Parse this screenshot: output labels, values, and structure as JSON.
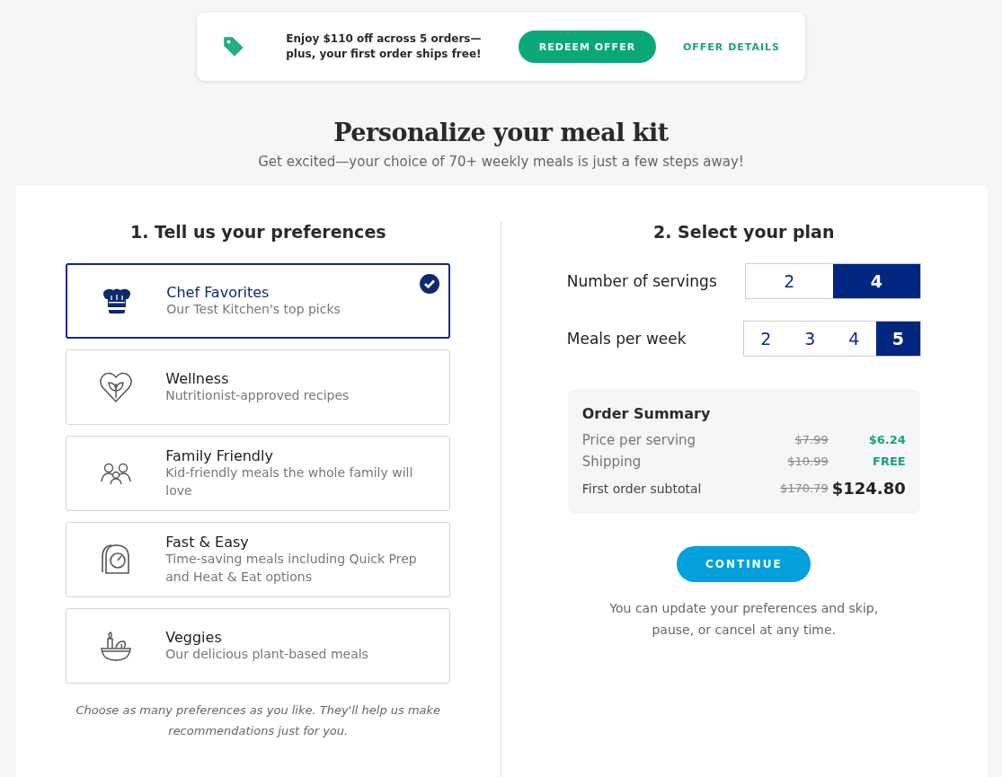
{
  "promo": {
    "message": "Enjoy $110 off across 5 orders—plus, your first order ships free!",
    "redeem": "REDEEM OFFER",
    "details": "OFFER DETAILS"
  },
  "heading": {
    "title": "Personalize your meal kit",
    "subtitle": "Get excited—your choice of 70+ weekly meals is just a few steps away!"
  },
  "preferences": {
    "title": "1. Tell us your preferences",
    "items": [
      {
        "kind": "chef",
        "name": "Chef Favorites",
        "description": "Our Test Kitchen's top picks",
        "selected": true
      },
      {
        "kind": "wellness",
        "name": "Wellness",
        "description": "Nutritionist-approved recipes",
        "selected": false
      },
      {
        "kind": "family",
        "name": "Family Friendly",
        "description": "Kid-friendly meals the whole family will love",
        "selected": false
      },
      {
        "kind": "fast",
        "name": "Fast & Easy",
        "description": "Time-saving meals including Quick Prep and Heat & Eat options",
        "selected": false
      },
      {
        "kind": "veggies",
        "name": "Veggies",
        "description": "Our delicious plant-based meals",
        "selected": false
      }
    ],
    "note": "Choose as many preferences as you like. They'll help us make recommendations just for you."
  },
  "plan": {
    "title": "2. Select your plan",
    "options": [
      {
        "label": "Number of servings",
        "choices": [
          {
            "label": "2",
            "selected": false
          },
          {
            "label": "4",
            "selected": true
          }
        ]
      },
      {
        "label": "Meals per week",
        "choices": [
          {
            "label": "2",
            "selected": false
          },
          {
            "label": "3",
            "selected": false
          },
          {
            "label": "4",
            "selected": false
          },
          {
            "label": "5",
            "selected": true
          }
        ]
      }
    ],
    "summary": {
      "title": "Order Summary",
      "rows": [
        {
          "kind": "line",
          "label": "Price per serving",
          "old": "$7.99",
          "new": "$6.24"
        },
        {
          "kind": "line",
          "label": "Shipping",
          "old": "$10.99",
          "new": "FREE"
        },
        {
          "kind": "total",
          "label": "First order subtotal",
          "old": "$170.79",
          "new": "$124.80"
        }
      ]
    },
    "continue": "CONTINUE",
    "note": "You can update your preferences and skip, pause, or cancel at any time."
  }
}
